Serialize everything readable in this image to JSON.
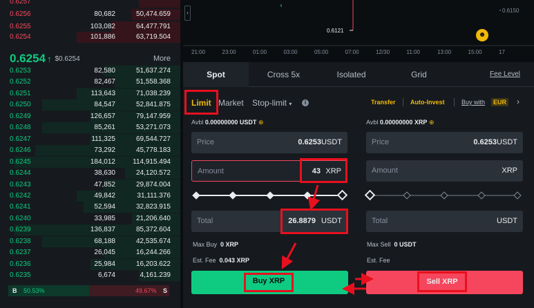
{
  "orderbook": {
    "asks": [
      {
        "price": "0.6257",
        "amount": "",
        "total": ""
      },
      {
        "price": "0.6256",
        "amount": "80,682",
        "total": "50,474.659"
      },
      {
        "price": "0.6255",
        "amount": "103,082",
        "total": "64,477.791"
      },
      {
        "price": "0.6254",
        "amount": "101,886",
        "total": "63,719.504"
      }
    ],
    "mid_price": "0.6254",
    "mid_arrow": "↑",
    "mid_usd": "$0.6254",
    "more_label": "More",
    "bids": [
      {
        "price": "0.6253",
        "amount": "82,580",
        "total": "51,637.274"
      },
      {
        "price": "0.6252",
        "amount": "82,467",
        "total": "51,558.368"
      },
      {
        "price": "0.6251",
        "amount": "113,643",
        "total": "71,038.239"
      },
      {
        "price": "0.6250",
        "amount": "84,547",
        "total": "52,841.875"
      },
      {
        "price": "0.6249",
        "amount": "126,657",
        "total": "79,147.959"
      },
      {
        "price": "0.6248",
        "amount": "85,261",
        "total": "53,271.073"
      },
      {
        "price": "0.6247",
        "amount": "111,325",
        "total": "69,544.727"
      },
      {
        "price": "0.6246",
        "amount": "73,292",
        "total": "45,778.183"
      },
      {
        "price": "0.6245",
        "amount": "184,012",
        "total": "114,915.494"
      },
      {
        "price": "0.6244",
        "amount": "38,630",
        "total": "24,120.572"
      },
      {
        "price": "0.6243",
        "amount": "47,852",
        "total": "29,874.004"
      },
      {
        "price": "0.6242",
        "amount": "49,842",
        "total": "31,111.376"
      },
      {
        "price": "0.6241",
        "amount": "52,594",
        "total": "32,823.915"
      },
      {
        "price": "0.6240",
        "amount": "33,985",
        "total": "21,206.640"
      },
      {
        "price": "0.6239",
        "amount": "136,837",
        "total": "85,372.604"
      },
      {
        "price": "0.6238",
        "amount": "68,188",
        "total": "42,535.674"
      },
      {
        "price": "0.6237",
        "amount": "26,045",
        "total": "16,244.266"
      },
      {
        "price": "0.6236",
        "amount": "25,984",
        "total": "16,203.622"
      },
      {
        "price": "0.6235",
        "amount": "6,674",
        "total": "4,161.239"
      }
    ],
    "buy_label": "B",
    "buy_pct": "50.53%",
    "sell_pct": "49.67%",
    "sell_label": "S"
  },
  "chart": {
    "price_right": "0.6150",
    "price_label": "0.6121",
    "times": [
      "21:00",
      "23:00",
      "01:00",
      "03:00",
      "05:00",
      "07:00",
      "12/30",
      "11:00",
      "13:00",
      "15:00",
      "17"
    ]
  },
  "tabs": [
    "Spot",
    "Cross 5x",
    "Isolated",
    "Grid"
  ],
  "fee_level": "Fee Level",
  "order_types": {
    "limit": "Limit",
    "market": "Market",
    "stop": "Stop-limit"
  },
  "links": {
    "transfer": "Transfer",
    "auto_invest": "Auto-Invest",
    "buy_with": "Buy with",
    "currency": "EUR"
  },
  "buy": {
    "avbl_label": "Avbl",
    "avbl_value": "0.00000000 USDT",
    "price_label": "Price",
    "price_value": "0.6253",
    "price_unit": "USDT",
    "amount_label": "Amount",
    "amount_value": "43",
    "amount_unit": "XRP",
    "total_label": "Total",
    "total_value": "26.8879",
    "total_unit": "USDT",
    "max_label": "Max Buy",
    "max_value": "0 XRP",
    "fee_label": "Est. Fee",
    "fee_value": "0.043 XRP",
    "button": "Buy XRP"
  },
  "sell": {
    "avbl_label": "Avbl",
    "avbl_value": "0.00000000 XRP",
    "price_label": "Price",
    "price_value": "0.6253",
    "price_unit": "USDT",
    "amount_label": "Amount",
    "amount_unit": "XRP",
    "total_label": "Total",
    "total_unit": "USDT",
    "max_label": "Max Sell",
    "max_value": "0 USDT",
    "fee_label": "Est. Fee",
    "button": "Sell XRP"
  },
  "colors": {
    "bid": "#0ecb81",
    "ask": "#f6465d",
    "accent": "#f0b90b",
    "highlight": "#e8101e"
  }
}
